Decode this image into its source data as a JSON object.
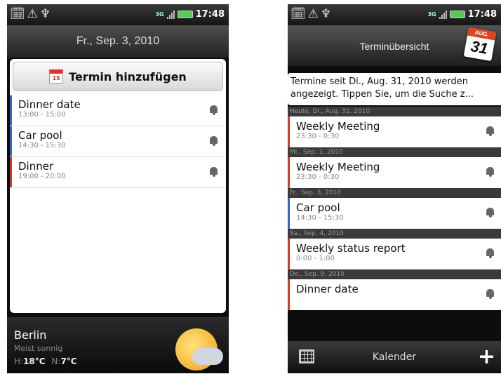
{
  "left": {
    "status": {
      "icons": "🗓⚠♆",
      "network": "3G",
      "time": "17:48"
    },
    "date_title": "Fr., Sep. 3, 2010",
    "add_button": {
      "label": "Termin hinzufügen",
      "icon_day": "15"
    },
    "events": [
      {
        "title": "Dinner date",
        "time": "13:00 - 15:00",
        "color": "#3a5fd0"
      },
      {
        "title": "Car pool",
        "time": "14:30 - 15:30",
        "color": "#3a5fd0"
      },
      {
        "title": "Dinner",
        "time": "19:00 - 20:00",
        "color": "#d23a2a"
      }
    ],
    "weather": {
      "city": "Berlin",
      "description": "Meist sonnig",
      "high_label": "H:",
      "high": "18°C",
      "low_label": "N:",
      "low": "7°C"
    }
  },
  "right": {
    "status": {
      "icons": "🗓⚠♆",
      "network": "3G",
      "time": "17:48"
    },
    "title": "Terminübersicht",
    "calendar_icon": {
      "month": "AUG.",
      "day": "31"
    },
    "notice_line1": "Termine seit Di., Aug. 31, 2010 werden",
    "notice_line2": "angezeigt. Tippen Sie, um die Suche z...",
    "groups": [
      {
        "header": "Heute, Di., Aug. 31, 2010",
        "title": "Weekly Meeting",
        "time": "23:30 - 0:30",
        "color": "#d23a2a"
      },
      {
        "header": "Mi., Sep. 1, 2010",
        "title": "Weekly Meeting",
        "time": "23:30 - 0:30",
        "color": "#d23a2a"
      },
      {
        "header": "Fr., Sep. 3, 2010",
        "title": "Car pool",
        "time": "14:30 - 15:30",
        "color": "#3a5fd0"
      },
      {
        "header": "Sa., Sep. 4, 2010",
        "title": "Weekly status report",
        "time": "0:00 - 1:00",
        "color": "#d23a2a"
      },
      {
        "header": "Do., Sep. 9, 2010",
        "title": "Dinner date",
        "time": "",
        "color": "#d23a2a"
      }
    ],
    "bottom_label": "Kalender"
  }
}
